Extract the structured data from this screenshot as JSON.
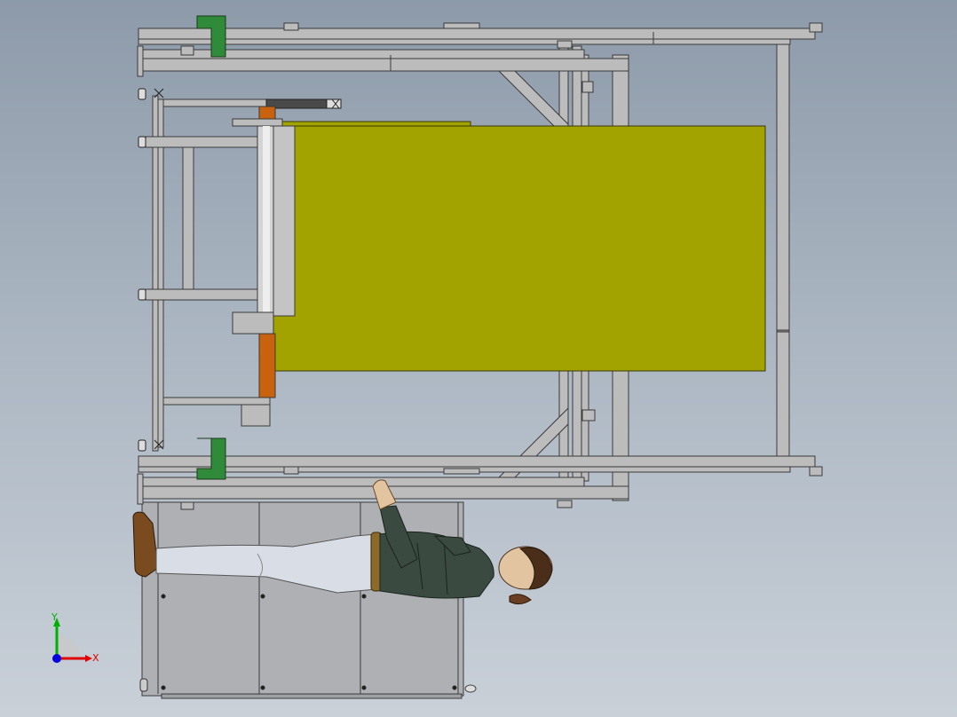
{
  "viewport": {
    "background_top": "#8d9aa9",
    "background_bottom": "#c9d0d8"
  },
  "colors": {
    "frame": "#bcbcbc",
    "frame_edge": "#3a3a3a",
    "panel_yellow": "#a3a300",
    "roller_orange": "#c8620f",
    "clamp_green": "#2f8a3a",
    "floor_panel": "#aeb0b3",
    "figure_suit": "#3b4a40",
    "figure_pants": "#d9dde6",
    "figure_shoes": "#7a4b1e",
    "axis_x": "#e00000",
    "axis_y": "#00b000",
    "axis_z": "#0000e0"
  },
  "triad": {
    "x_label": "X",
    "y_label": "Y"
  },
  "icons": {
    "triad": "coordinate-triad-icon"
  }
}
